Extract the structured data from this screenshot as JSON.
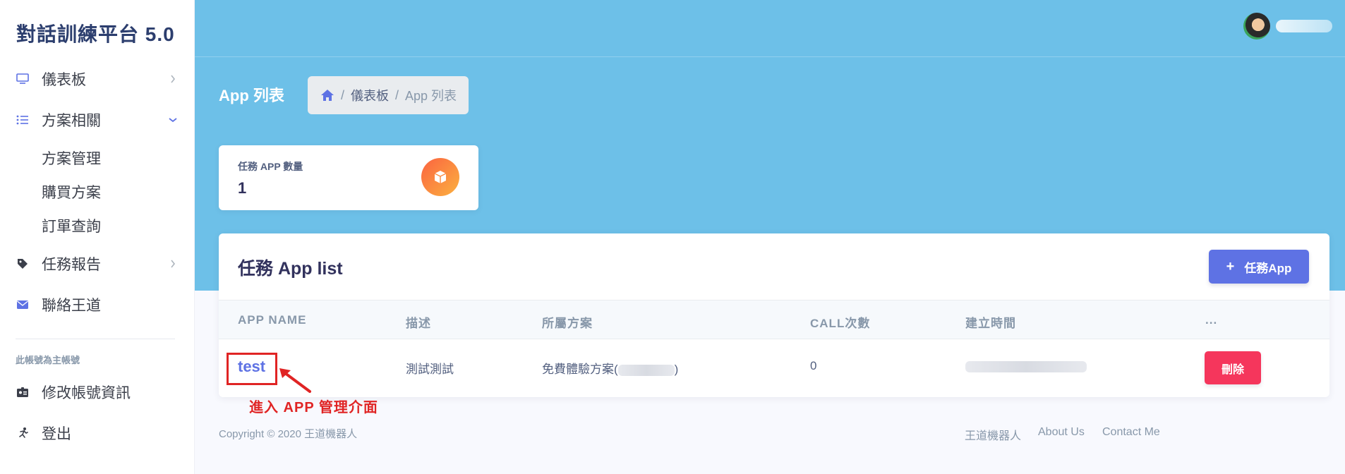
{
  "sidebar": {
    "brand": "對話訓練平台 5.0",
    "items": [
      {
        "label": "儀表板",
        "icon": "monitor-icon"
      },
      {
        "label": "方案相關",
        "icon": "list-icon"
      },
      {
        "label": "任務報告",
        "icon": "tag-icon"
      },
      {
        "label": "聯絡王道",
        "icon": "envelope-icon"
      }
    ],
    "sub_items": [
      "方案管理",
      "購買方案",
      "訂單查詢"
    ],
    "account_heading": "此帳號為主帳號",
    "account_items": [
      {
        "label": "修改帳號資訊",
        "icon": "id-card-icon"
      },
      {
        "label": "登出",
        "icon": "running-icon"
      }
    ]
  },
  "header": {
    "page_title": "App 列表",
    "breadcrumb": [
      "儀表板",
      "App 列表"
    ]
  },
  "stat_card": {
    "label": "任務 APP 數量",
    "value": "1"
  },
  "app_list": {
    "title": "任務 App list",
    "add_button": "任務App",
    "columns": [
      "APP NAME",
      "描述",
      "所屬方案",
      "CALL次數",
      "建立時間",
      "..."
    ],
    "rows": [
      {
        "name": "test",
        "description": "測試測試",
        "plan": "免費體驗方案(",
        "plan_close": ")",
        "calls": "0",
        "action": "刪除"
      }
    ]
  },
  "annotation": {
    "text": "進入 APP 管理介面"
  },
  "footer": {
    "copyright": "Copyright © 2020 王道機器人",
    "links": [
      "王道機器人",
      "About Us",
      "Contact Me"
    ]
  },
  "colors": {
    "header_bg": "#6dc0e8",
    "primary": "#5e72e4",
    "danger": "#f5365c",
    "annotation": "#e02424"
  }
}
